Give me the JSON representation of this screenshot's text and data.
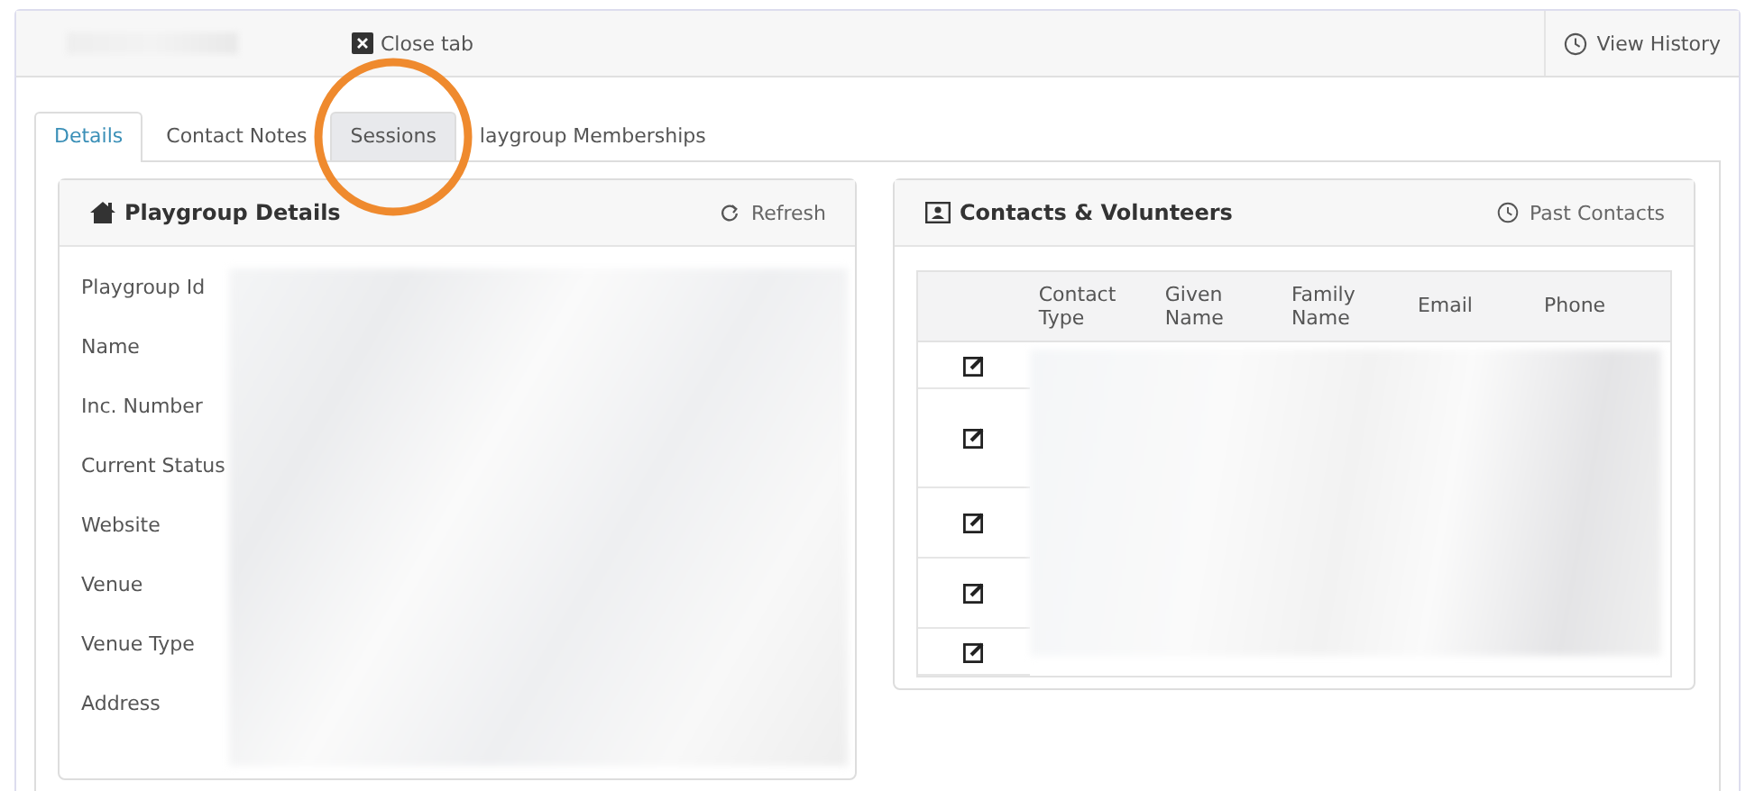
{
  "header": {
    "close_tab": "Close tab",
    "view_history": "View History"
  },
  "tabs": [
    {
      "label": "Details",
      "selected": true,
      "highlighted": false
    },
    {
      "label": "Contact Notes",
      "selected": false,
      "highlighted": false
    },
    {
      "label": "Sessions",
      "selected": false,
      "highlighted": true
    },
    {
      "label": "laygroup Memberships",
      "selected": false,
      "highlighted": false
    }
  ],
  "details_panel": {
    "title": "Playgroup Details",
    "refresh": "Refresh",
    "fields": [
      "Playgroup Id",
      "Name",
      "Inc. Number",
      "Current Status",
      "Website",
      "Venue",
      "Venue Type",
      "Address"
    ]
  },
  "contacts_panel": {
    "title": "Contacts & Volunteers",
    "past_contacts": "Past Contacts",
    "columns": [
      "Contact Type",
      "Given Name",
      "Family Name",
      "Email",
      "Phone"
    ],
    "rows": [
      {
        "kind": "short"
      },
      {
        "kind": "tall"
      },
      {
        "kind": "medium"
      },
      {
        "kind": "medium"
      },
      {
        "kind": "short"
      }
    ]
  }
}
